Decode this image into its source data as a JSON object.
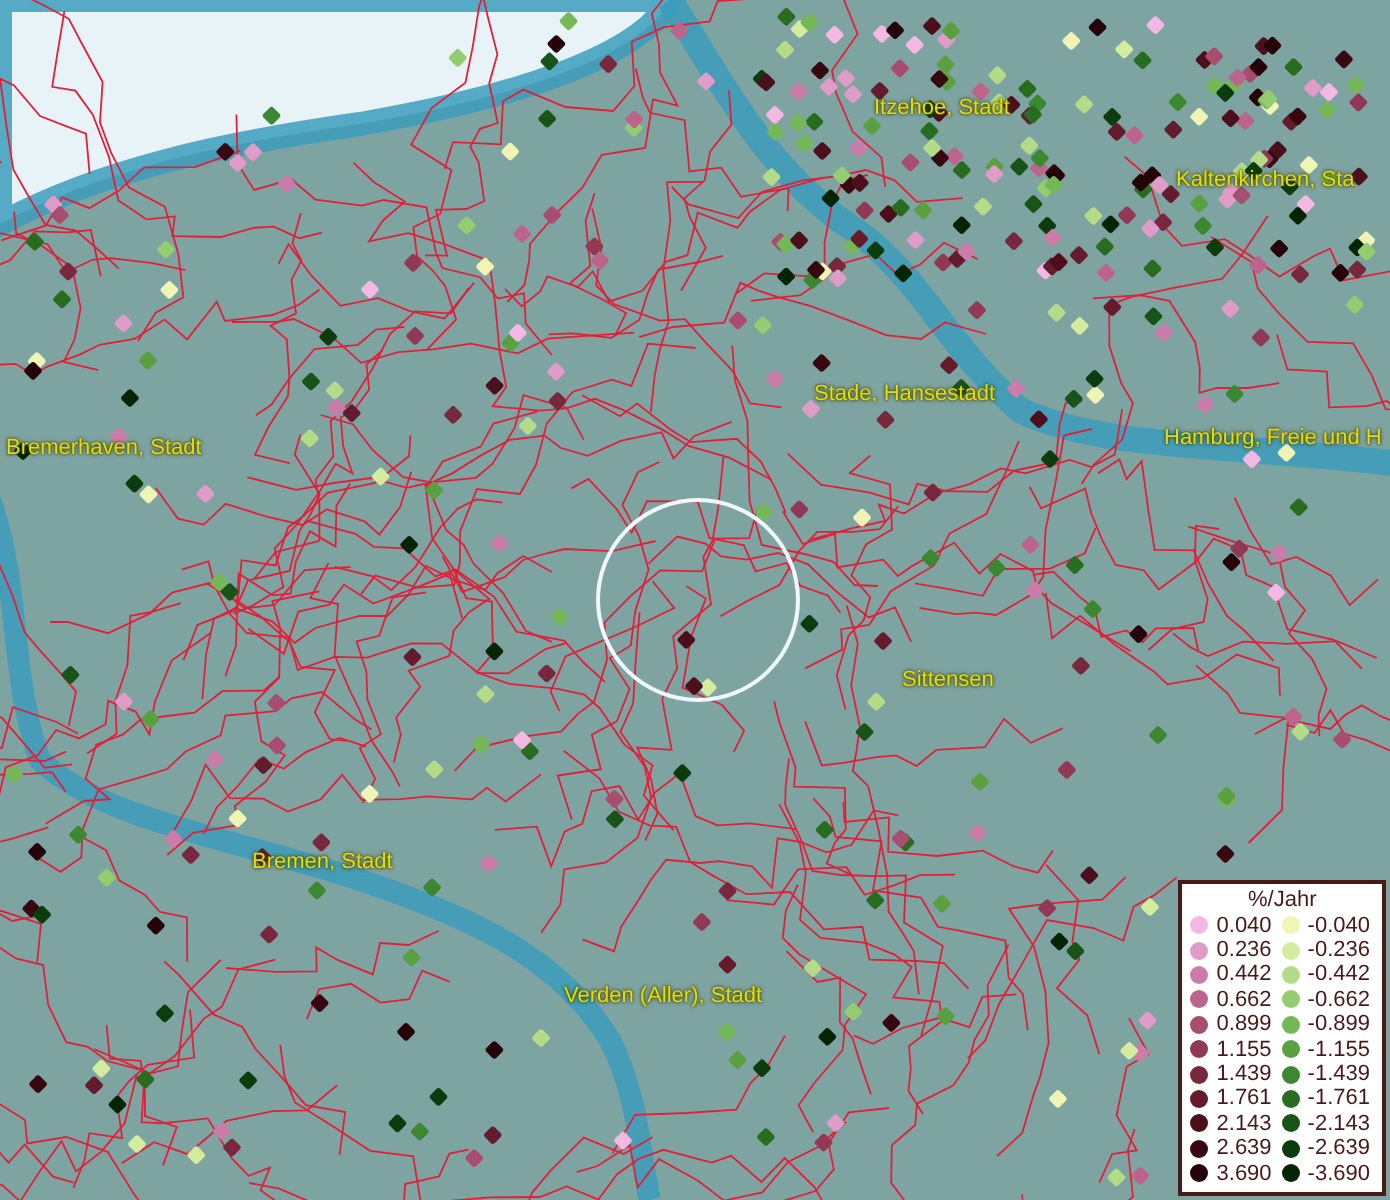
{
  "map": {
    "places": [
      {
        "label": "Itzehoe, Stadt"
      },
      {
        "label": "Kaltenkirchen, Sta"
      },
      {
        "label": "Stade, Hansestadt"
      },
      {
        "label": "Hamburg, Freie und H"
      },
      {
        "label": "Bremerhaven, Stadt"
      },
      {
        "label": "Sittensen"
      },
      {
        "label": "Bremen, Stadt"
      },
      {
        "label": "Verden (Aller), Stadt"
      }
    ]
  },
  "legend": {
    "title": "%/Jahr",
    "positive": [
      {
        "label": "0.040",
        "color": "#f4b8e4"
      },
      {
        "label": "0.236",
        "color": "#e09cc8"
      },
      {
        "label": "0.442",
        "color": "#cc7ca8"
      },
      {
        "label": "0.662",
        "color": "#bc648c"
      },
      {
        "label": "0.899",
        "color": "#a84c70"
      },
      {
        "label": "1.155",
        "color": "#903854"
      },
      {
        "label": "1.439",
        "color": "#78283c"
      },
      {
        "label": "1.761",
        "color": "#641c2c"
      },
      {
        "label": "2.143",
        "color": "#4c101c"
      },
      {
        "label": "2.639",
        "color": "#380810"
      },
      {
        "label": "3.690",
        "color": "#240408"
      }
    ],
    "negative": [
      {
        "label": "-0.040",
        "color": "#f0f4b4"
      },
      {
        "label": "-0.236",
        "color": "#d4eca0"
      },
      {
        "label": "-0.442",
        "color": "#b4dc88"
      },
      {
        "label": "-0.662",
        "color": "#94cc70"
      },
      {
        "label": "-0.899",
        "color": "#74b858"
      },
      {
        "label": "-1.155",
        "color": "#58a040"
      },
      {
        "label": "-1.439",
        "color": "#3c8830"
      },
      {
        "label": "-1.761",
        "color": "#286c20"
      },
      {
        "label": "-2.143",
        "color": "#185418"
      },
      {
        "label": "-2.639",
        "color": "#0c3c0c"
      },
      {
        "label": "-3.690",
        "color": "#042404"
      }
    ]
  }
}
